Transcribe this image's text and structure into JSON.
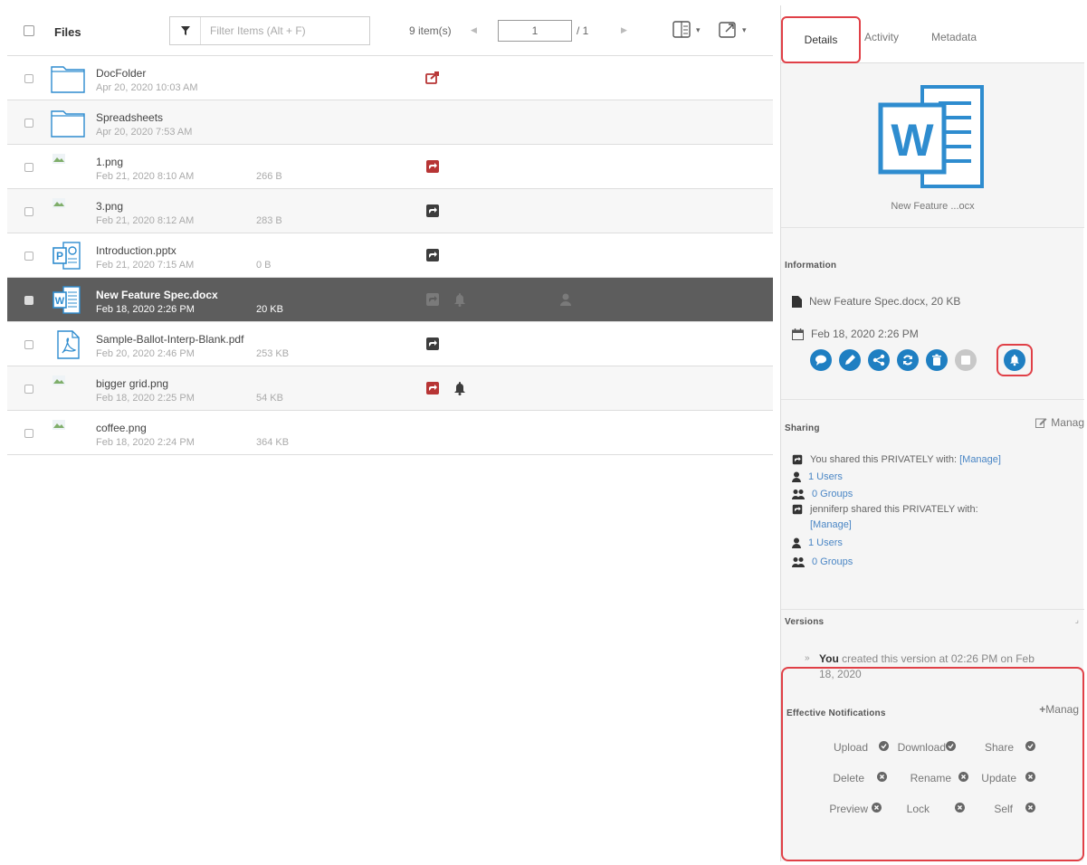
{
  "toolbar": {
    "files_label": "Files",
    "filter_placeholder": "Filter Items (Alt + F)",
    "item_count": "9 item(s)",
    "page_current": "1",
    "page_total": "/ 1"
  },
  "files": [
    {
      "name": "DocFolder",
      "date": "Apr 20, 2020 10:03 AM",
      "size": "",
      "icon": "folder-icon",
      "share": "red-out",
      "bell": false
    },
    {
      "name": "Spreadsheets",
      "date": "Apr 20, 2020 7:53 AM",
      "size": "",
      "icon": "folder-icon",
      "share": "",
      "bell": false
    },
    {
      "name": "1.png",
      "date": "Feb 21, 2020 8:10 AM",
      "size": "266 B",
      "icon": "broken-image-icon",
      "share": "red",
      "bell": false
    },
    {
      "name": "3.png",
      "date": "Feb 21, 2020 8:12 AM",
      "size": "283 B",
      "icon": "broken-image-icon",
      "share": "dark",
      "bell": false
    },
    {
      "name": "Introduction.pptx",
      "date": "Feb 21, 2020 7:15 AM",
      "size": "0 B",
      "icon": "powerpoint-icon",
      "share": "dark",
      "bell": false
    },
    {
      "name": "New Feature Spec.docx",
      "date": "Feb 18, 2020 2:26 PM",
      "size": "20 KB",
      "icon": "word-icon",
      "share": "grey",
      "bell": true
    },
    {
      "name": "Sample-Ballot-Interp-Blank.pdf",
      "date": "Feb 20, 2020 2:46 PM",
      "size": "253 KB",
      "icon": "pdf-icon",
      "share": "dark",
      "bell": false
    },
    {
      "name": "bigger grid.png",
      "date": "Feb 18, 2020 2:25 PM",
      "size": "54 KB",
      "icon": "broken-image-icon",
      "share": "red",
      "bell": true
    },
    {
      "name": "coffee.png",
      "date": "Feb 18, 2020 2:24 PM",
      "size": "364 KB",
      "icon": "broken-image-icon",
      "share": "",
      "bell": false
    }
  ],
  "panel": {
    "tabs": {
      "details": "Details",
      "activity": "Activity",
      "metadata": "Metadata"
    },
    "preview_name": "New Feature ...ocx",
    "information": {
      "title": "Information",
      "file_line": "New Feature Spec.docx, 20 KB",
      "date_line": "Feb 18, 2020 2:26 PM"
    },
    "sharing": {
      "title": "Sharing",
      "manage": "Manag",
      "line1_text": "You shared this PRIVATELY with:",
      "line1_link": "[Manage]",
      "users1": "1 Users",
      "groups1": "0 Groups",
      "line2_text": "jenniferp shared this PRIVATELY with:",
      "line2_link": "[Manage]",
      "users2": "1 Users",
      "groups2": "0 Groups"
    },
    "versions": {
      "title": "Versions",
      "you": "You",
      "text1": "created this version at 02:26 PM on Feb",
      "text2": "18, 2020"
    },
    "notifications": {
      "title": "Effective Notifications",
      "manage": "Manag",
      "upload": "Upload",
      "download": "Download",
      "share": "Share",
      "delete": "Delete",
      "rename": "Rename",
      "update": "Update",
      "preview": "Preview",
      "lock": "Lock",
      "self": "Self"
    }
  },
  "colors": {
    "accent_blue": "#1f7fc2",
    "highlight_red": "#e04047",
    "selected_row": "#5d5d5d"
  }
}
